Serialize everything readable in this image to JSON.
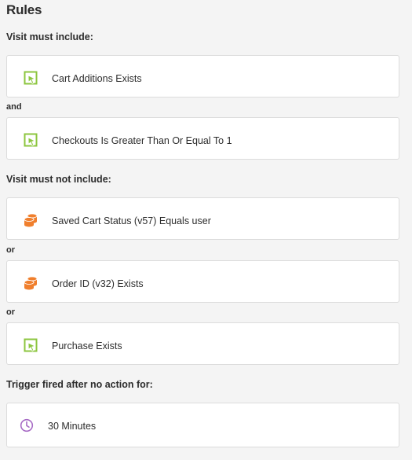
{
  "page": {
    "title": "Rules"
  },
  "include": {
    "label": "Visit must include:",
    "connector": "and",
    "rules": [
      {
        "icon": "metric-icon",
        "text": "Cart Additions Exists"
      },
      {
        "icon": "metric-icon",
        "text": "Checkouts Is Greater Than Or Equal To 1"
      }
    ]
  },
  "exclude": {
    "label": "Visit must not include:",
    "connectors": [
      "or",
      "or"
    ],
    "rules": [
      {
        "icon": "dimension-icon",
        "text": "Saved Cart Status (v57) Equals user"
      },
      {
        "icon": "dimension-icon",
        "text": "Order ID (v32) Exists"
      },
      {
        "icon": "metric-icon",
        "text": "Purchase Exists"
      }
    ]
  },
  "trigger": {
    "label": "Trigger fired after no action for:",
    "icon": "clock-icon",
    "value": "30 Minutes"
  },
  "colors": {
    "metric": "#8cc63f",
    "dimension": "#f07f2d",
    "time": "#a76bc5"
  }
}
